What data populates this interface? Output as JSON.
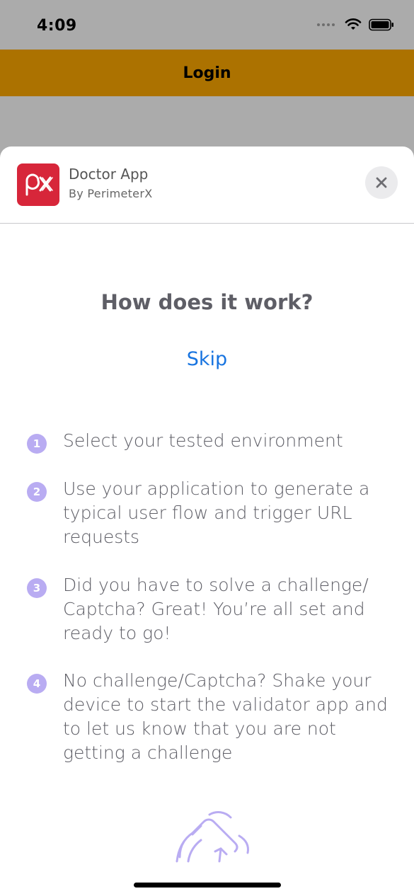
{
  "status_bar": {
    "time": "4:09"
  },
  "nav": {
    "title": "Login"
  },
  "app": {
    "icon_text": "px",
    "name": "Doctor App",
    "publisher": "By PerimeterX"
  },
  "main": {
    "heading": "How does it work?",
    "skip_label": "Skip",
    "steps": [
      {
        "number": "1",
        "text": "Select your tested environment"
      },
      {
        "number": "2",
        "text": "Use your application to generate a typical user flow and trigger URL requests"
      },
      {
        "number": "3",
        "text": "Did you have to solve a challenge/ Captcha? Great! You’re all set and ready to go!"
      },
      {
        "number": "4",
        "text": "No challenge/Captcha? Shake your device to start the validator app and to let us know that you are not getting a challenge"
      }
    ]
  },
  "colors": {
    "nav_bar": "#ac7200",
    "brand_red": "#d7263a",
    "link_blue": "#1874e0",
    "step_badge": "#b9acf2"
  },
  "icons": [
    "signal-dots-icon",
    "wifi-icon",
    "battery-icon",
    "close-icon",
    "shake-hand-icon"
  ]
}
